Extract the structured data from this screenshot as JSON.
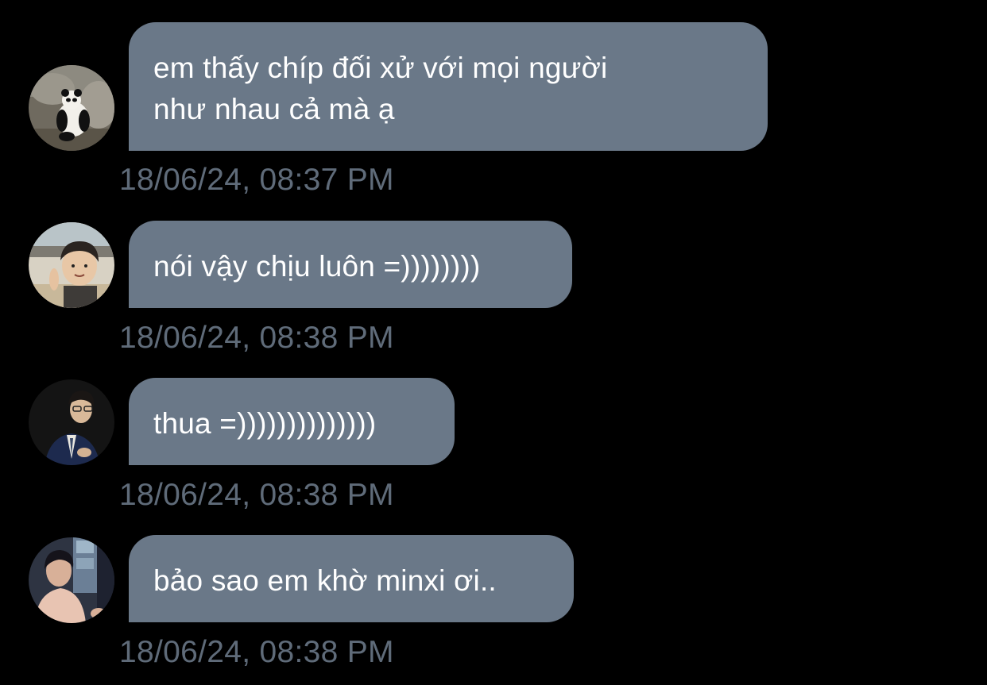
{
  "messages": [
    {
      "avatar_icon": "panda-avatar-icon",
      "text": "em thấy chíp đối xử với mọi người\nnhư nhau cả mà ạ",
      "timestamp": "18/06/24, 08:37 PM"
    },
    {
      "avatar_icon": "child-avatar-icon",
      "text": "nói vậy chịu luôn =))))))))",
      "timestamp": "18/06/24, 08:38 PM"
    },
    {
      "avatar_icon": "man-in-suit-avatar-icon",
      "text": "thua =))))))))))))))",
      "timestamp": "18/06/24, 08:38 PM"
    },
    {
      "avatar_icon": "person-avatar-icon",
      "text": "bảo sao em khờ minxi ơi..",
      "timestamp": "18/06/24, 08:38 PM"
    }
  ],
  "colors": {
    "background": "#000000",
    "bubble": "#6a7888",
    "bubble_text": "#ffffff",
    "timestamp_text": "#5f6b79"
  }
}
